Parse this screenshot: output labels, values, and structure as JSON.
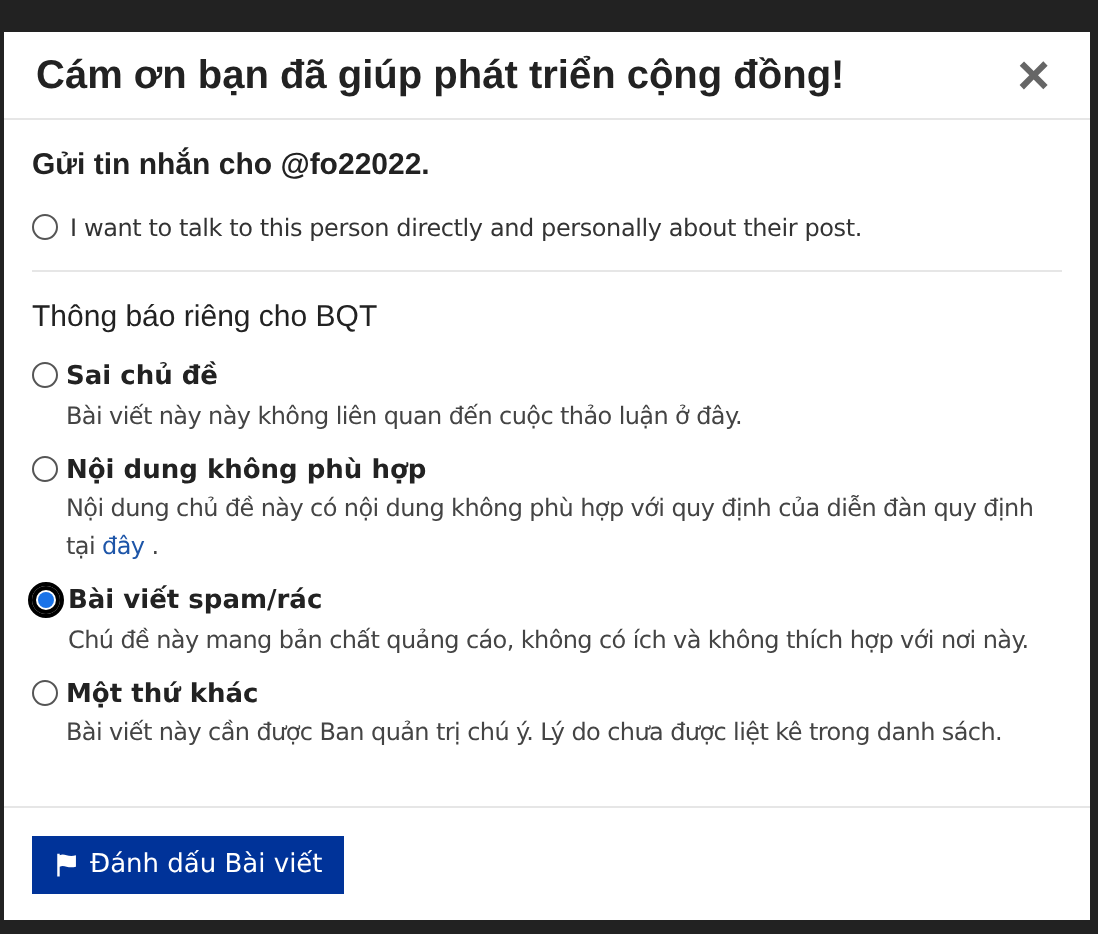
{
  "dialog": {
    "title": "Cám ơn bạn đã giúp phát triển cộng đồng!",
    "close": "×"
  },
  "message_section": {
    "heading": "Gửi tin nhắn cho @fo22022.",
    "options": [
      {
        "label": "I want to talk to this person directly and personally about their post.",
        "selected": false
      }
    ]
  },
  "moderator_section": {
    "heading": "Thông báo riêng cho BQT",
    "options": [
      {
        "label": "Sai chủ đề",
        "description": "Bài viết này này không liên quan đến cuộc thảo luận ở đây.",
        "selected": false
      },
      {
        "label": "Nội dung không phù hợp",
        "description": "Nội dung chủ đề này có nội dung không phù hợp với quy định của diễn đàn quy định tại",
        "link": "đây",
        "after_link": ".",
        "selected": false
      },
      {
        "label": "Bài viết spam/rác",
        "description": "Chú đề này mang bản chất quảng cáo, không có ích và không thích hợp với nơi này.",
        "selected": true
      },
      {
        "label": "Một thứ khác",
        "description": "Bài viết này cần được Ban quản trị chú ý. Lý do chưa được liệt kê trong danh sách.",
        "selected": false
      }
    ]
  },
  "submit_button": {
    "label": "Đánh dấu Bài viết"
  }
}
